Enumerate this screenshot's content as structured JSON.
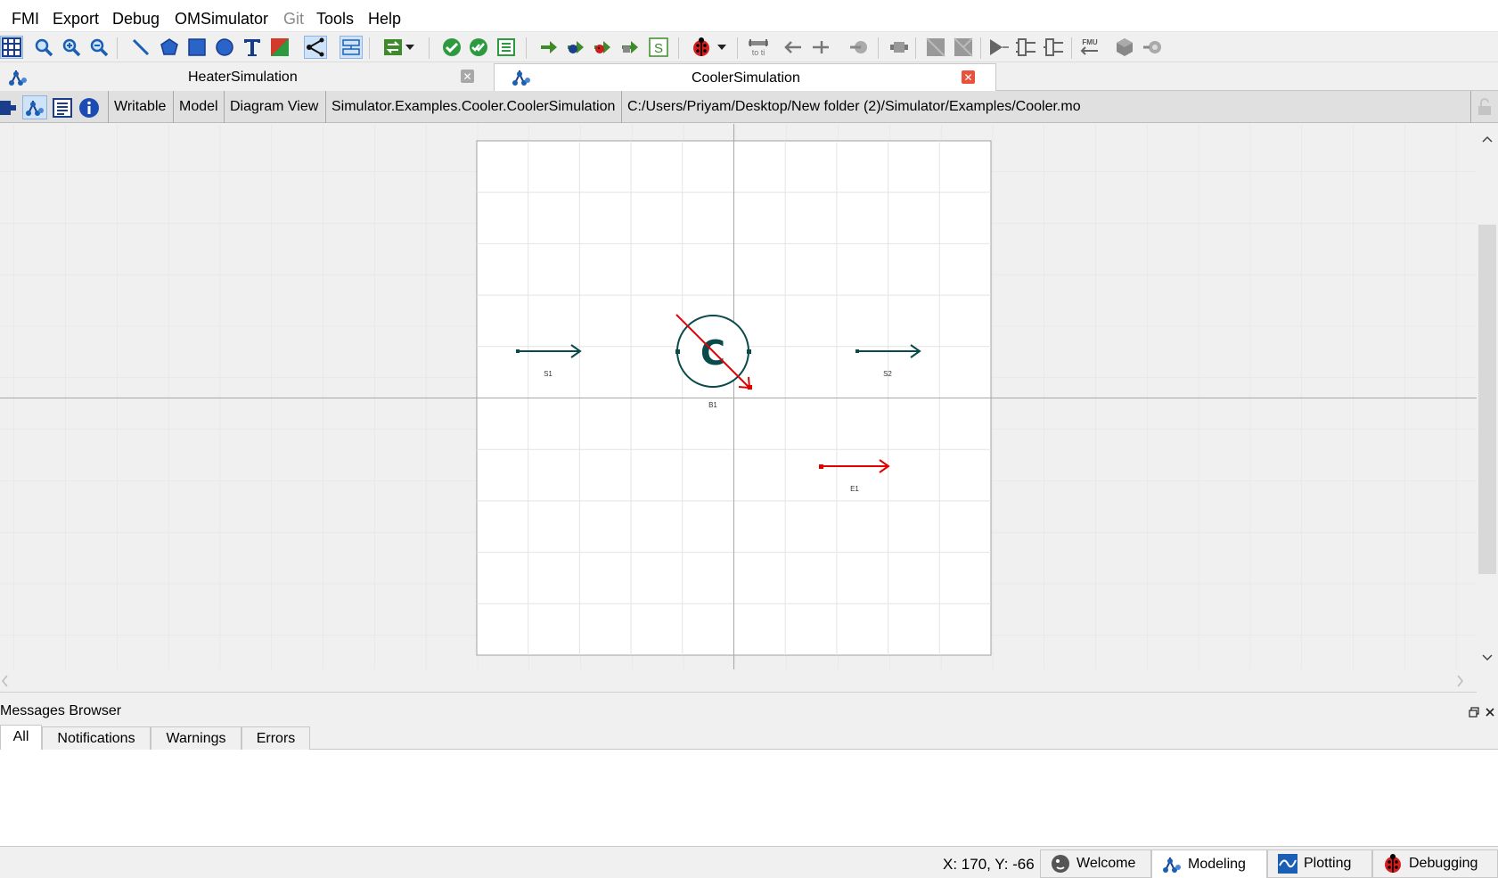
{
  "menu": {
    "items": [
      {
        "label": "FMI",
        "mnemonic": "F"
      },
      {
        "label": "Export",
        "mnemonic": "E"
      },
      {
        "label": "Debug",
        "mnemonic": "D"
      },
      {
        "label": "OMSimulator",
        "mnemonic": "O"
      },
      {
        "label": "Git",
        "mnemonic": "G"
      },
      {
        "label": "Tools",
        "mnemonic": "T"
      },
      {
        "label": "Help",
        "mnemonic": "H"
      }
    ]
  },
  "toolbar": {
    "icons": [
      "grid-icon",
      "zoom-reset-icon",
      "zoom-in-icon",
      "zoom-out-icon",
      "line-icon",
      "polygon-icon",
      "rectangle-icon",
      "ellipse-icon",
      "text-icon",
      "bitmap-icon",
      "connect-mode-icon",
      "transition-mode-icon",
      "swap-icon",
      "check-model-icon",
      "check-all-models-icon",
      "instantiate-model-icon",
      "simulate-icon",
      "simulate-with-transformational-debugger-icon",
      "simulate-with-algorithmic-debugger-icon",
      "simulate-with-animation-icon",
      "simulation-setup-icon",
      "debug-configuration-icon",
      "align-interfaces-icon",
      "add-connector-icon",
      "add-bus-icon",
      "add-tlm-bus-icon",
      "add-submodel-icon",
      "instantiate-model-disabled-icon",
      "simulate-disabled-icon",
      "add-system-icon",
      "add-subsystem-icon",
      "export-fmu-icon",
      "import-fmu-icon",
      "ssp-icon",
      "animation-icon"
    ]
  },
  "tabs": [
    {
      "label": "HeaterSimulation",
      "active": false
    },
    {
      "label": "CoolerSimulation",
      "active": true
    }
  ],
  "infobar": {
    "access": "Writable",
    "class_type": "Model",
    "view": "Diagram View",
    "class_name": "Simulator.Examples.Cooler.CoolerSimulation",
    "file_path": "C:/Users/Priyam/Desktop/New folder (2)/Simulator/Examples/Cooler.mo"
  },
  "diagram": {
    "components": [
      {
        "name": "S1"
      },
      {
        "name": "B1",
        "symbol": "C"
      },
      {
        "name": "S2"
      },
      {
        "name": "E1"
      }
    ]
  },
  "messages": {
    "title": "Messages Browser",
    "tabs": [
      "All",
      "Notifications",
      "Warnings",
      "Errors"
    ],
    "active_tab": "All"
  },
  "status": {
    "coordinates": "X: 170, Y: -66",
    "perspectives": [
      {
        "label": "Welcome",
        "active": false
      },
      {
        "label": "Modeling",
        "active": true
      },
      {
        "label": "Plotting",
        "active": false
      },
      {
        "label": "Debugging",
        "active": false
      }
    ]
  },
  "colors": {
    "stream": "#0a4a4a",
    "energy": "#e00000",
    "accent": "#1a5fb4"
  }
}
